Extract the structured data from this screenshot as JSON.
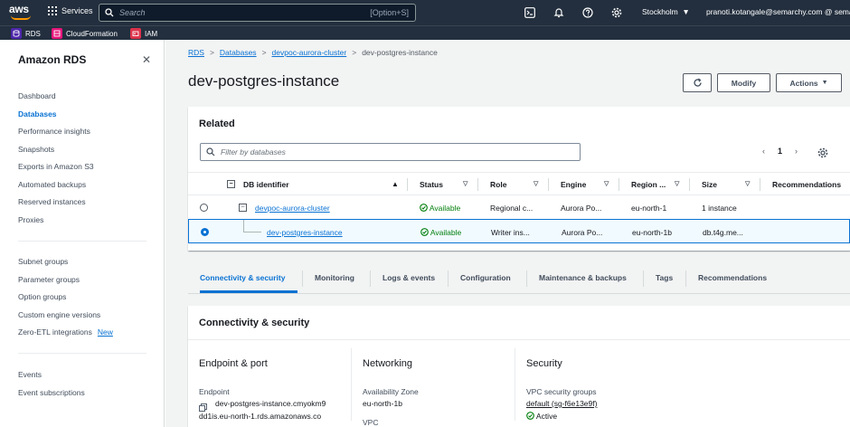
{
  "topnav": {
    "logo_text": "aws",
    "services_label": "Services",
    "search_placeholder": "Search",
    "search_shortcut": "[Option+S]",
    "region": "Stockholm",
    "account": "pranoti.kotangale@semarchy.com @ semarch"
  },
  "favorites": [
    {
      "label": "RDS",
      "color": "#4d27aa"
    },
    {
      "label": "CloudFormation",
      "color": "#e7157b"
    },
    {
      "label": "IAM",
      "color": "#dd344c"
    }
  ],
  "sidebar": {
    "title": "Amazon RDS",
    "items_group1": [
      "Dashboard",
      "Databases",
      "Performance insights",
      "Snapshots",
      "Exports in Amazon S3",
      "Automated backups",
      "Reserved instances",
      "Proxies"
    ],
    "items_group2": [
      "Subnet groups",
      "Parameter groups",
      "Option groups",
      "Custom engine versions",
      "Zero-ETL integrations"
    ],
    "new_badge": "New",
    "items_group3": [
      "Events",
      "Event subscriptions"
    ],
    "active": "Databases"
  },
  "breadcrumb": {
    "items": [
      "RDS",
      "Databases",
      "devpoc-aurora-cluster"
    ],
    "current": "dev-postgres-instance",
    "separator": ">"
  },
  "page": {
    "title": "dev-postgres-instance",
    "modify_label": "Modify",
    "actions_label": "Actions"
  },
  "related": {
    "title": "Related",
    "filter_placeholder": "Filter by databases",
    "page_number": "1",
    "columns": [
      "DB identifier",
      "Status",
      "Role",
      "Engine",
      "Region ...",
      "Size",
      "Recommendations"
    ],
    "rows": [
      {
        "id": "devpoc-aurora-cluster",
        "status": "Available",
        "role": "Regional c...",
        "engine": "Aurora Po...",
        "region": "eu-north-1",
        "size": "1 instance",
        "recommendations": ""
      },
      {
        "id": "dev-postgres-instance",
        "status": "Available",
        "role": "Writer ins...",
        "engine": "Aurora Po...",
        "region": "eu-north-1b",
        "size": "db.t4g.me...",
        "recommendations": ""
      }
    ]
  },
  "tabs": [
    "Connectivity & security",
    "Monitoring",
    "Logs & events",
    "Configuration",
    "Maintenance & backups",
    "Tags",
    "Recommendations"
  ],
  "connectivity": {
    "title": "Connectivity & security",
    "endpoint_heading": "Endpoint & port",
    "endpoint_label": "Endpoint",
    "endpoint_value_line1": "dev-postgres-instance.cmyokm9",
    "endpoint_value_line2": "dd1is.eu-north-1.rds.amazonaws.co",
    "networking_heading": "Networking",
    "az_label": "Availability Zone",
    "az_value": "eu-north-1b",
    "vpc_label_partial": "VPC",
    "security_heading": "Security",
    "sg_label": "VPC security groups",
    "sg_value": "default (sg-f6e13e9f)",
    "sg_status": "Active"
  },
  "colors": {
    "topnav_bg": "#232f3e",
    "link": "#0972d3",
    "success": "#037f0c",
    "page_bg": "#f2f3f3"
  }
}
